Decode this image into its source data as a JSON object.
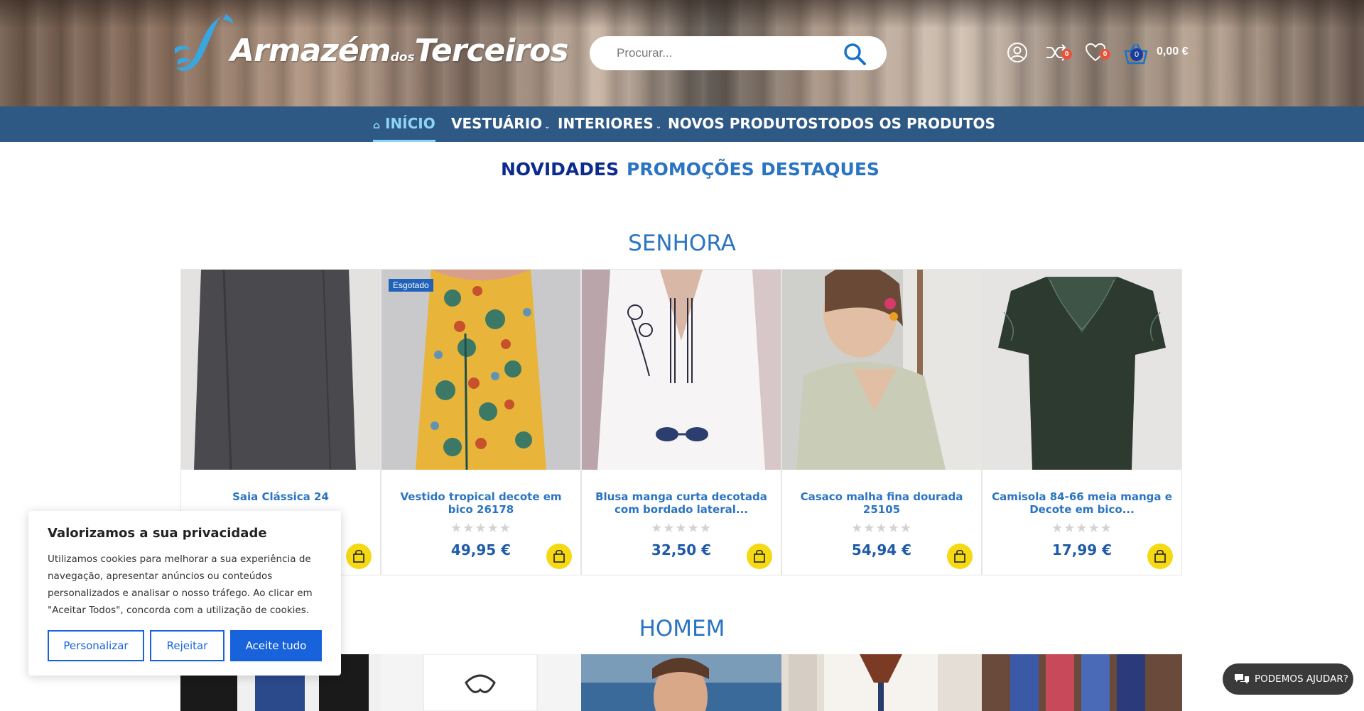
{
  "header": {
    "logo_text": "Armazém",
    "logo_small": "dos",
    "logo_text2": "Terceiros",
    "search_placeholder": "Procurar...",
    "compare_count": "0",
    "wishlist_count": "0",
    "cart_count": "0",
    "cart_total": "0,00 €"
  },
  "nav": {
    "items": [
      {
        "label": "INÍCIO"
      },
      {
        "label": "VESTUÁRIO"
      },
      {
        "label": "INTERIORES"
      },
      {
        "label": "NOVOS PRODUTOS"
      },
      {
        "label": "TODOS OS PRODUTOS"
      }
    ]
  },
  "tabs": [
    "NOVIDADES",
    "PROMOÇÕES",
    "DESTAQUES"
  ],
  "sections": {
    "women": "SENHORA",
    "men": "HOMEM"
  },
  "products": [
    {
      "title": "Saia Clássica 24",
      "price": "",
      "rating": 0
    },
    {
      "title": "Vestido tropical decote em bico 26178",
      "price": "49,95 €",
      "badge": "Esgotado",
      "rating": 0
    },
    {
      "title": "Blusa manga curta decotada com bordado lateral...",
      "price": "32,50 €",
      "rating": 0
    },
    {
      "title": "Casaco malha fina dourada 25105",
      "price": "54,94 €",
      "rating": 0
    },
    {
      "title": "Camisola 84-66 meia manga e Decote em bico...",
      "price": "17,99 €",
      "rating": 0
    }
  ],
  "cookie": {
    "title": "Valorizamos a sua privacidade",
    "text": "Utilizamos cookies para melhorar a sua experiência de navegação, apresentar anúncios ou conteúdos personalizados e analisar o nosso tráfego. Ao clicar em \"Aceitar Todos\", concorda com a utilização de cookies.",
    "customize": "Personalizar",
    "reject": "Rejeitar",
    "accept": "Aceite tudo"
  },
  "chat": {
    "label": "PODEMOS AJUDAR?"
  },
  "colors": {
    "nav_bg": "#2d5984",
    "accent_blue": "#2b74c2",
    "active_tab": "#0d2b8e",
    "cart_button": "#f5d915",
    "cookie_primary": "#1863dc"
  }
}
